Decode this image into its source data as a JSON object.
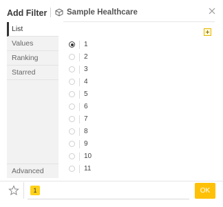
{
  "header": {
    "title": "Add Filter",
    "datasource": "Sample Healthcare"
  },
  "nav": {
    "items": [
      {
        "label": "List",
        "active": true
      },
      {
        "label": "Values",
        "active": false
      },
      {
        "label": "Ranking",
        "active": false
      },
      {
        "label": "Starred",
        "active": false
      }
    ],
    "advanced": "Advanced"
  },
  "list": {
    "selected": "1",
    "items": [
      "1",
      "2",
      "3",
      "4",
      "5",
      "6",
      "7",
      "8",
      "9",
      "10",
      "11"
    ]
  },
  "footer": {
    "chip_value": "1",
    "ok_label": "OK"
  },
  "colors": {
    "accent": "#ffc107",
    "chip": "#ffd11a"
  }
}
